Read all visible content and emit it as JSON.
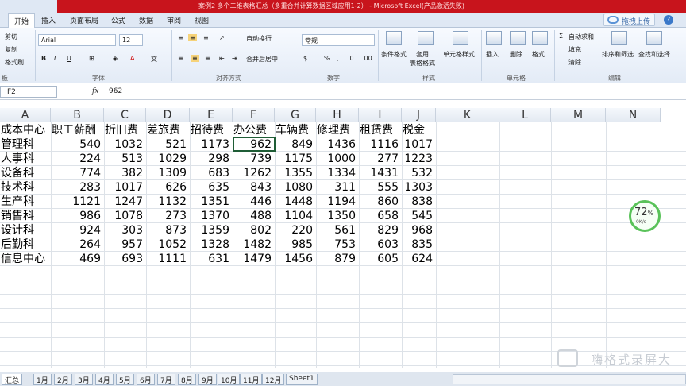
{
  "window": {
    "title": "案例2 多个二维表格汇总（多重合并计算数据区域应用1-2） - Microsoft Excel(产品激活失败)"
  },
  "ribbon_tabs": [
    "开始",
    "插入",
    "页面布局",
    "公式",
    "数据",
    "审阅",
    "视图"
  ],
  "active_tab": "开始",
  "upload_label": "拖拽上传",
  "clipboard": {
    "cut": "剪切",
    "copy": "复制",
    "format_painter": "格式刷",
    "label": "板"
  },
  "font": {
    "name": "Arial",
    "size": "12",
    "label": "字体"
  },
  "alignment": {
    "wrap": "自动换行",
    "merge": "合并后居中",
    "label": "对齐方式"
  },
  "number": {
    "format": "常规",
    "label": "数字"
  },
  "styles": {
    "conditional": "条件格式",
    "table_format": "套用\n表格格式",
    "cell_styles": "单元格样式",
    "label": "样式"
  },
  "cells": {
    "insert": "插入",
    "delete": "删除",
    "format": "格式",
    "label": "单元格"
  },
  "editing": {
    "autosum": "自动求和",
    "fill": "填充",
    "clear": "清除",
    "sort": "排序和筛选",
    "find": "查找和选择",
    "label": "编辑"
  },
  "formula_bar": {
    "name_box": "F2",
    "fx": "fx",
    "value": "962"
  },
  "columns": [
    "A",
    "B",
    "C",
    "D",
    "E",
    "F",
    "G",
    "H",
    "I",
    "J",
    "K",
    "L",
    "M",
    "N"
  ],
  "table": {
    "headers": [
      "成本中心",
      "职工薪酬",
      "折旧费",
      "差旅费",
      "招待费",
      "办公费",
      "车辆费",
      "修理费",
      "租赁费",
      "税金"
    ],
    "rows": [
      [
        "管理科",
        "540",
        "1032",
        "521",
        "1173",
        "962",
        "849",
        "1436",
        "1116",
        "1017"
      ],
      [
        "人事科",
        "224",
        "513",
        "1029",
        "298",
        "739",
        "1175",
        "1000",
        "277",
        "1223"
      ],
      [
        "设备科",
        "774",
        "382",
        "1309",
        "683",
        "1262",
        "1355",
        "1334",
        "1431",
        "532"
      ],
      [
        "技术科",
        "283",
        "1017",
        "626",
        "635",
        "843",
        "1080",
        "311",
        "555",
        "1303"
      ],
      [
        "生产科",
        "1121",
        "1247",
        "1132",
        "1351",
        "446",
        "1448",
        "1194",
        "860",
        "838"
      ],
      [
        "销售科",
        "986",
        "1078",
        "273",
        "1370",
        "488",
        "1104",
        "1350",
        "658",
        "545"
      ],
      [
        "设计科",
        "924",
        "303",
        "873",
        "1359",
        "802",
        "220",
        "561",
        "829",
        "968"
      ],
      [
        "后勤科",
        "264",
        "957",
        "1052",
        "1328",
        "1482",
        "985",
        "753",
        "603",
        "835"
      ],
      [
        "信息中心",
        "469",
        "693",
        "1111",
        "631",
        "1479",
        "1456",
        "879",
        "605",
        "624"
      ]
    ]
  },
  "net_widget": {
    "percent": "72",
    "percent_unit": "%",
    "speed": "0K/s"
  },
  "sheet_tabs": [
    "汇总",
    "1月",
    "2月",
    "3月",
    "4月",
    "5月",
    "6月",
    "7月",
    "8月",
    "9月",
    "10月",
    "11月",
    "12月",
    "Sheet1"
  ],
  "watermark": "嗨格式录屏大"
}
